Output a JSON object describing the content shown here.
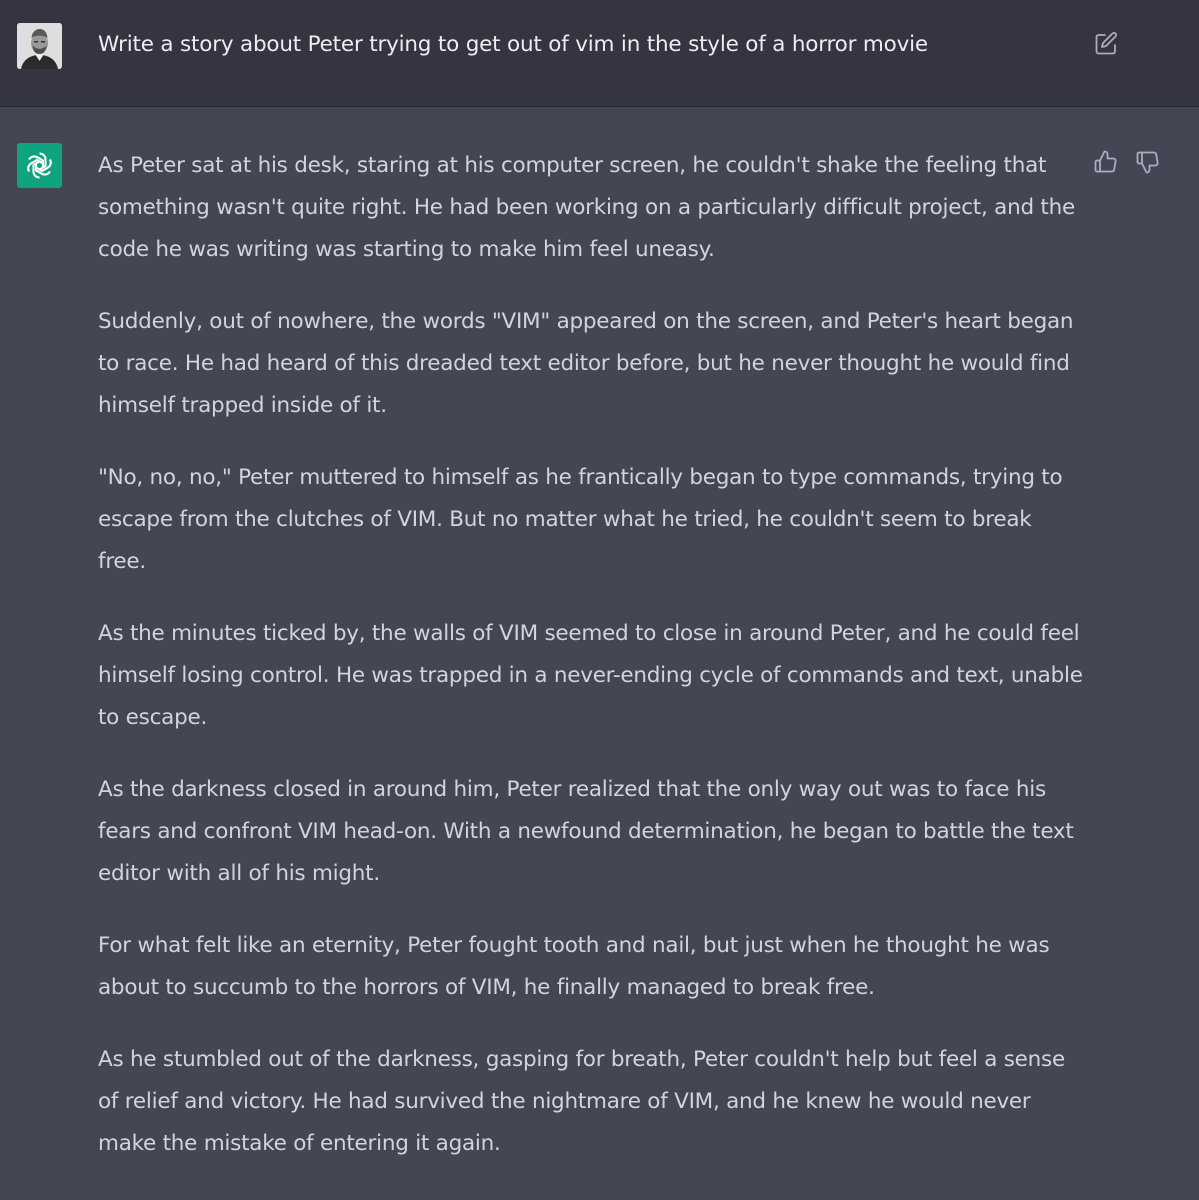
{
  "conversation": {
    "user_prompt": "Write a story about Peter trying to get out of vim in the style of a horror movie",
    "assistant_paragraphs": [
      "As Peter sat at his desk, staring at his computer screen, he couldn't shake the feeling that something wasn't quite right. He had been working on a particularly difficult project, and the code he was writing was starting to make him feel uneasy.",
      "Suddenly, out of nowhere, the words \"VIM\" appeared on the screen, and Peter's heart began to race. He had heard of this dreaded text editor before, but he never thought he would find himself trapped inside of it.",
      "\"No, no, no,\" Peter muttered to himself as he frantically began to type commands, trying to escape from the clutches of VIM. But no matter what he tried, he couldn't seem to break free.",
      "As the minutes ticked by, the walls of VIM seemed to close in around Peter, and he could feel himself losing control. He was trapped in a never-ending cycle of commands and text, unable to escape.",
      "As the darkness closed in around him, Peter realized that the only way out was to face his fears and confront VIM head-on. With a newfound determination, he began to battle the text editor with all of his might.",
      "For what felt like an eternity, Peter fought tooth and nail, but just when he thought he was about to succumb to the horrors of VIM, he finally managed to break free.",
      "As he stumbled out of the darkness, gasping for breath, Peter couldn't help but feel a sense of relief and victory. He had survived the nightmare of VIM, and he knew he would never make the mistake of entering it again."
    ]
  },
  "icons": {
    "user_avatar": "user-avatar-photo",
    "edit": "pencil-square-icon",
    "assistant_avatar": "openai-logo-icon",
    "thumbs_up": "thumbs-up-icon",
    "thumbs_down": "thumbs-down-icon"
  },
  "colors": {
    "user_row_bg": "#343541",
    "assistant_row_bg": "#444654",
    "assistant_logo_bg": "#10a37f",
    "text": "#d1d5db",
    "icon": "#acacbe"
  }
}
